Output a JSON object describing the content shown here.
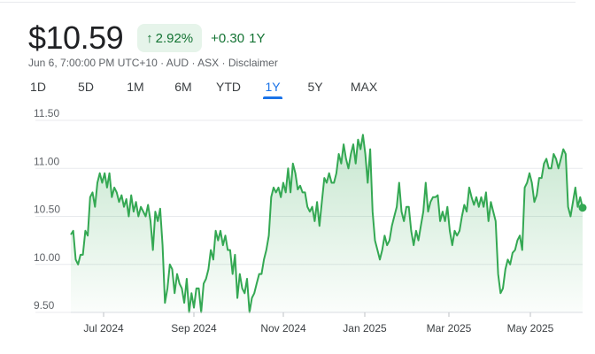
{
  "quote": {
    "price": "$10.59",
    "change_pct": "2.92%",
    "change_abs": "+0.30",
    "period": "1Y",
    "timestamp": "Jun 6, 7:00:00 PM UTC+10",
    "currency": "AUD",
    "exchange": "ASX",
    "disclaimer": "Disclaimer"
  },
  "tabs": [
    {
      "label": "1D",
      "active": false
    },
    {
      "label": "5D",
      "active": false
    },
    {
      "label": "1M",
      "active": false
    },
    {
      "label": "6M",
      "active": false
    },
    {
      "label": "YTD",
      "active": false
    },
    {
      "label": "1Y",
      "active": true
    },
    {
      "label": "5Y",
      "active": false
    },
    {
      "label": "MAX",
      "active": false
    }
  ],
  "colors": {
    "up": "#137333",
    "line": "#34a853",
    "accent": "#1a73e8"
  },
  "chart_data": {
    "type": "area",
    "ylim": [
      9.5,
      11.5
    ],
    "yticks": [
      "11.50",
      "11.00",
      "10.50",
      "10.00",
      "9.50"
    ],
    "xticks": [
      "Jul 2024",
      "Sep 2024",
      "Nov 2024",
      "Jan 2025",
      "Mar 2025",
      "May 2025"
    ],
    "grid": true,
    "series": [
      {
        "values": [
          10.31,
          10.35,
          10.05,
          10.0,
          10.1,
          10.1,
          10.35,
          10.3,
          10.7,
          10.75,
          10.6,
          10.85,
          10.95,
          10.85,
          10.95,
          10.8,
          10.95,
          10.7,
          10.8,
          10.75,
          10.65,
          10.72,
          10.6,
          10.68,
          10.5,
          10.72,
          10.55,
          10.65,
          10.5,
          10.6,
          10.55,
          10.5,
          10.62,
          10.45,
          10.15,
          10.55,
          10.45,
          10.58,
          10.2,
          9.6,
          9.75,
          10.0,
          9.95,
          9.7,
          9.9,
          9.8,
          9.75,
          9.6,
          9.85,
          9.5,
          9.7,
          9.55,
          9.75,
          9.75,
          9.5,
          9.8,
          9.85,
          9.95,
          10.15,
          10.05,
          10.35,
          10.25,
          10.35,
          10.2,
          10.3,
          10.15,
          10.15,
          9.9,
          10.1,
          9.65,
          9.9,
          9.75,
          9.7,
          9.85,
          9.5,
          9.65,
          9.7,
          9.8,
          9.9,
          9.9,
          10.05,
          10.15,
          10.3,
          10.7,
          10.8,
          10.75,
          10.8,
          10.7,
          10.85,
          10.75,
          11.0,
          10.75,
          11.05,
          10.95,
          10.78,
          10.82,
          10.75,
          10.75,
          10.6,
          10.55,
          10.6,
          10.45,
          10.65,
          10.4,
          10.65,
          10.9,
          10.85,
          10.95,
          10.85,
          10.85,
          10.95,
          11.15,
          11.05,
          11.25,
          11.1,
          11.0,
          11.15,
          11.25,
          11.05,
          11.3,
          11.2,
          11.35,
          11.15,
          10.85,
          11.2,
          10.55,
          10.25,
          10.15,
          10.05,
          10.15,
          10.3,
          10.2,
          10.25,
          10.4,
          10.5,
          10.6,
          10.85,
          10.55,
          10.45,
          10.6,
          10.6,
          10.35,
          10.2,
          10.35,
          10.25,
          10.4,
          10.55,
          10.85,
          10.55,
          10.65,
          10.7,
          10.7,
          10.72,
          10.45,
          10.55,
          10.45,
          10.6,
          10.35,
          10.2,
          10.35,
          10.3,
          10.35,
          10.5,
          10.62,
          10.55,
          10.8,
          10.7,
          10.62,
          10.7,
          10.6,
          10.7,
          10.6,
          10.75,
          10.45,
          10.65,
          10.55,
          10.45,
          9.9,
          9.7,
          9.75,
          9.95,
          10.05,
          10.0,
          10.12,
          10.15,
          10.25,
          10.3,
          10.15,
          10.8,
          10.85,
          10.95,
          10.85,
          10.65,
          10.72,
          10.9,
          10.9,
          11.05,
          11.1,
          11.0,
          11.0,
          11.15,
          11.1,
          11.0,
          11.1,
          11.2,
          11.15,
          10.6,
          10.5,
          10.65,
          10.8,
          10.6,
          10.7,
          10.59
        ]
      }
    ]
  }
}
